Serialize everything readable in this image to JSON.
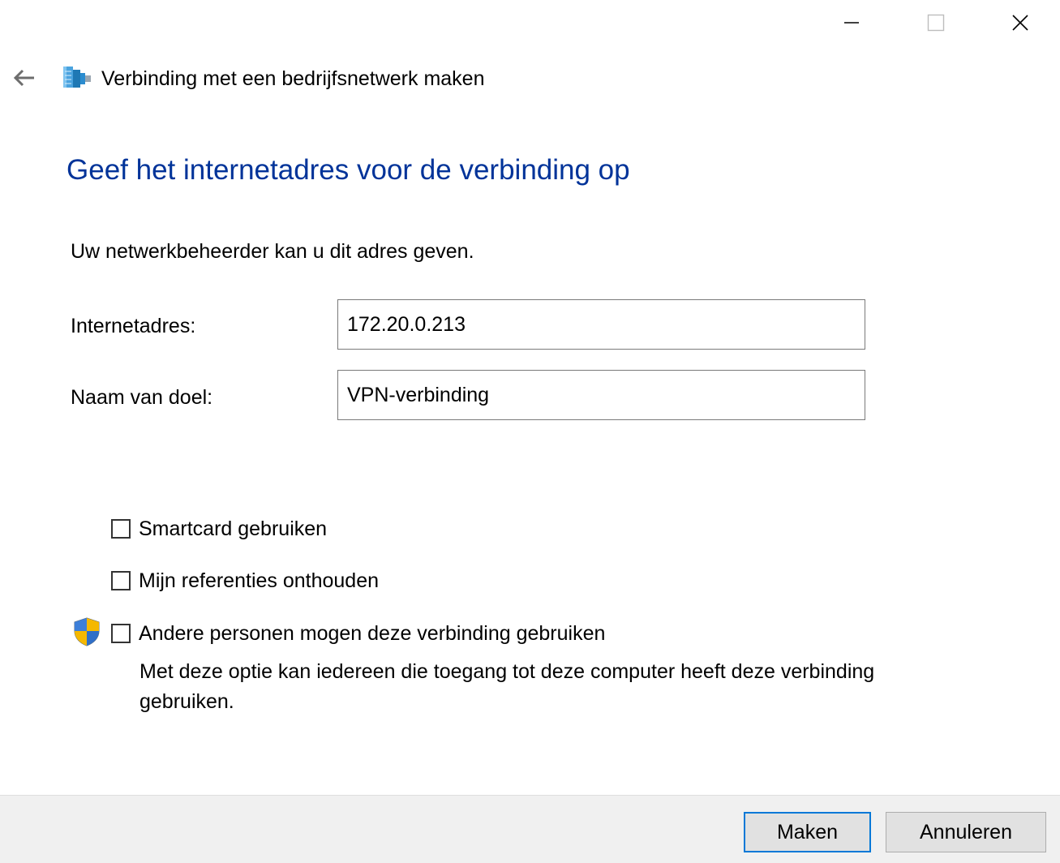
{
  "window": {
    "title": "Verbinding met een bedrijfsnetwerk maken",
    "icons": {
      "back": "arrow-left-icon",
      "app": "network-connection-icon",
      "minimize": "minimize-icon",
      "maximize": "maximize-icon",
      "close": "close-icon",
      "shield": "uac-shield-icon"
    }
  },
  "page": {
    "heading": "Geef het internetadres voor de verbinding op",
    "intro": "Uw netwerkbeheerder kan u dit adres geven.",
    "heading_color": "#003399"
  },
  "form": {
    "address_label": "Internetadres:",
    "address_value": "172.20.0.213",
    "name_label": "Naam van doel:",
    "name_value": "VPN-verbinding"
  },
  "options": {
    "smartcard": {
      "label": "Smartcard gebruiken",
      "checked": false
    },
    "remember": {
      "label": "Mijn referenties onthouden",
      "checked": false
    },
    "others": {
      "label": "Andere personen mogen deze verbinding gebruiken",
      "checked": false
    },
    "others_note": "Met deze optie kan iedereen die toegang tot deze computer heeft deze verbinding gebruiken."
  },
  "footer": {
    "create_label": "Maken",
    "cancel_label": "Annuleren",
    "accent_color": "#0078d7"
  }
}
